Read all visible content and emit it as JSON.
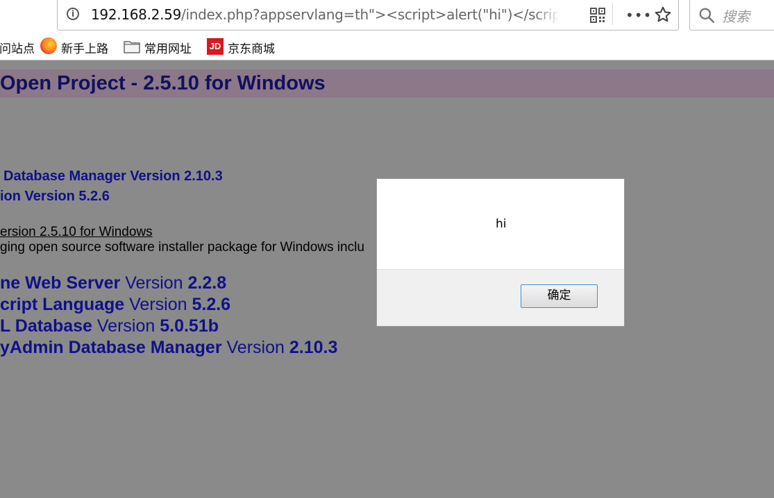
{
  "browser": {
    "url_host": "192.168.2.59",
    "url_path": "/index.php?appservlang=th\"><script>alert(\"hi\")</scrip",
    "search_placeholder": "搜索"
  },
  "bookmarks": [
    {
      "label": "访问站点"
    },
    {
      "label": "新手上路"
    },
    {
      "label": "常用网址"
    },
    {
      "label": "京东商城",
      "icon_text": "JD"
    }
  ],
  "page": {
    "title": "Open Project - 2.5.10 for Windows",
    "lines_small": [
      "Database Manager Version 2.10.3",
      "ion Version 5.2.6"
    ],
    "link_text": "ersion 2.5.10 for Windows",
    "description": "ging open source software installer package for Windows inclu",
    "components": [
      {
        "name": "ne Web Server",
        "word": "Version",
        "version": "2.2.8"
      },
      {
        "name": "cript Language",
        "word": "Version",
        "version": "5.2.6"
      },
      {
        "name": "L Database",
        "word": "Version",
        "version": "5.0.51b"
      },
      {
        "name": "yAdmin Database Manager",
        "word": "Version",
        "version": "2.10.3"
      }
    ]
  },
  "dialog": {
    "message": "hi",
    "ok_label": "确定"
  }
}
